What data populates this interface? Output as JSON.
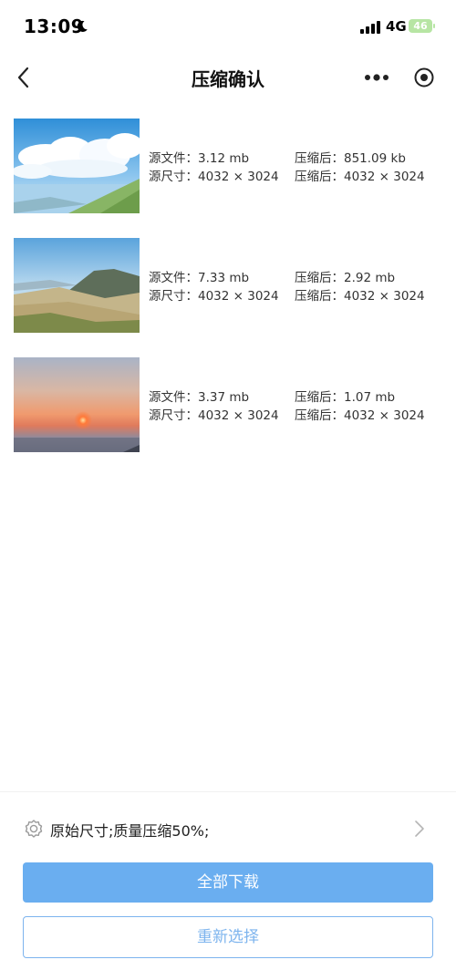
{
  "status_bar": {
    "time": "13:09",
    "network": "4G",
    "battery": "46"
  },
  "nav": {
    "title": "压缩确认"
  },
  "images": [
    {
      "source_file": "源文件：3.12 mb",
      "source_size": "源尺寸：4032 × 3024",
      "compressed_file": "压缩后：851.09 kb",
      "compressed_size": "压缩后：4032 × 3024"
    },
    {
      "source_file": "源文件：7.33 mb",
      "source_size": "源尺寸：4032 × 3024",
      "compressed_file": "压缩后：2.92 mb",
      "compressed_size": "压缩后：4032 × 3024"
    },
    {
      "source_file": "源文件：3.37 mb",
      "source_size": "源尺寸：4032 × 3024",
      "compressed_file": "压缩后：1.07 mb",
      "compressed_size": "压缩后：4032 × 3024"
    }
  ],
  "settings": {
    "label": "原始尺寸;质量压缩50%;"
  },
  "buttons": {
    "download_all": "全部下载",
    "reselect": "重新选择"
  },
  "colors": {
    "primary_button": "#6aaef0",
    "secondary_border": "#7db4ee",
    "battery": "#b7e5a4"
  }
}
